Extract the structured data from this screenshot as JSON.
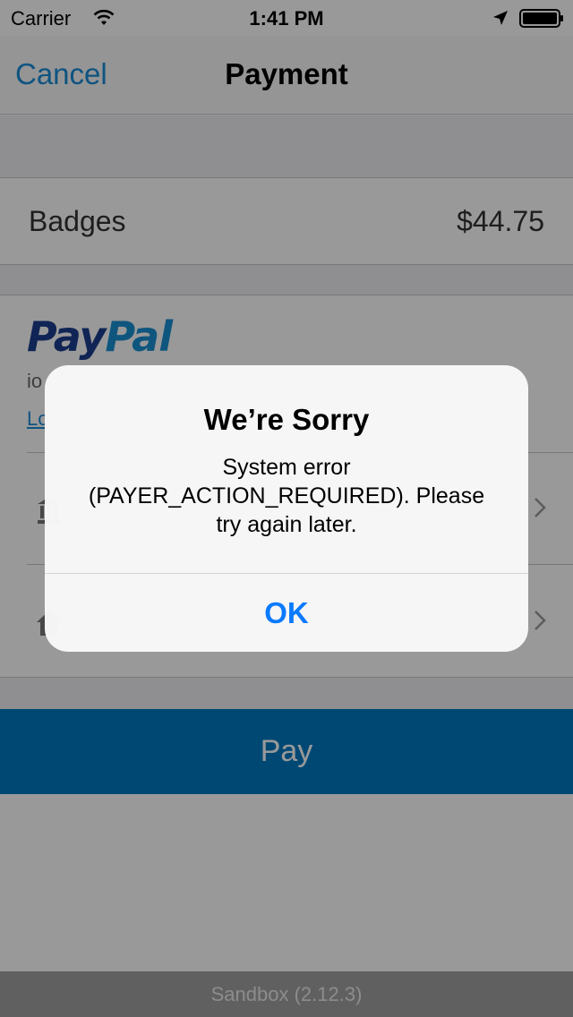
{
  "status_bar": {
    "carrier": "Carrier",
    "time": "1:41 PM",
    "wifi_icon": "wifi-icon",
    "location_icon": "location-arrow-icon",
    "battery_icon": "battery-full-icon"
  },
  "nav": {
    "cancel_label": "Cancel",
    "title": "Payment"
  },
  "item": {
    "name": "Badges",
    "price": "$44.75"
  },
  "paypal": {
    "logo_pay": "Pay",
    "logo_pal": "Pal",
    "account_text": "io",
    "logout_label": "Lo",
    "funding_rows": [
      {
        "icon": "bank-icon"
      },
      {
        "icon": "home-icon"
      }
    ]
  },
  "pay_button": {
    "label": "Pay"
  },
  "footer": {
    "sandbox_label": "Sandbox (2.12.3)"
  },
  "alert": {
    "title": "We’re Sorry",
    "message": "System error (PAYER_ACTION_REQUIRED). Please try again later.",
    "ok_label": "OK"
  },
  "colors": {
    "accent": "#1a8cd8",
    "pay_button": "#0079c1",
    "paypal_dark": "#1b3f8e",
    "paypal_light": "#1a90d4",
    "alert_button": "#0a7aff"
  }
}
